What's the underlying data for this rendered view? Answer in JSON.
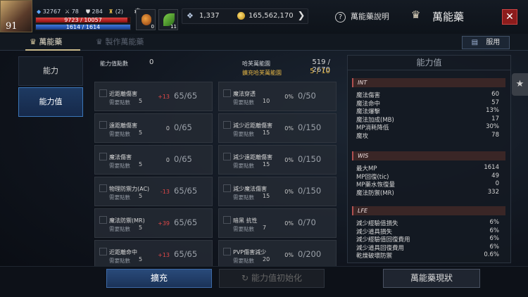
{
  "player": {
    "level": "91",
    "stat_a": "32767",
    "stat_b": "78",
    "stat_c": "284",
    "stat_d": "(2)",
    "hp_text": "9723 / 10057",
    "hp_fraction": 0.967,
    "mp_text": "1614 / 1614",
    "mp_fraction": 1.0,
    "slot1_count": "0",
    "slot2_count": "11"
  },
  "currency": {
    "crystal": "1,337",
    "gold": "165,562,170"
  },
  "header": {
    "help_label": "萬能藥說明",
    "title": "萬能藥",
    "close": "✕"
  },
  "tabs": {
    "tab1": "萬能藥",
    "tab2": "製作萬能藥",
    "serve": "服用"
  },
  "side": {
    "item1": "能力",
    "item2": "能力值"
  },
  "summary": {
    "points_label": "能力值點數",
    "points_value": "0",
    "gauge_label": "哈芙萬能園",
    "gauge_value": "519 / 2670",
    "expand_label": "擴充哈芙萬能園",
    "expand_value": "5 / 10"
  },
  "cards_left": [
    {
      "name": "近距離傷害",
      "need": "需要點數",
      "pts": "5",
      "mid": "+13",
      "val": "65/65"
    },
    {
      "name": "遠距離傷害",
      "need": "需要點數",
      "pts": "5",
      "mid": "0",
      "val": "0/65"
    },
    {
      "name": "魔法傷害",
      "need": "需要點數",
      "pts": "5",
      "mid": "0",
      "val": "0/65"
    },
    {
      "name": "物理防禦力(AC)",
      "need": "需要點數",
      "pts": "5",
      "mid": "-13",
      "val": "65/65"
    },
    {
      "name": "魔法防禦(MR)",
      "need": "需要點數",
      "pts": "5",
      "mid": "+39",
      "val": "65/65"
    },
    {
      "name": "近距離命中",
      "need": "需要點數",
      "pts": "5",
      "mid": "+13",
      "val": "65/65"
    }
  ],
  "cards_right": [
    {
      "name": "魔法穿透",
      "need": "需要點數",
      "pts": "10",
      "mid": "0%",
      "val": "0/50"
    },
    {
      "name": "減少近距離傷害",
      "need": "需要點數",
      "pts": "15",
      "mid": "0%",
      "val": "0/150"
    },
    {
      "name": "減少遠距離傷害",
      "need": "需要點數",
      "pts": "15",
      "mid": "0%",
      "val": "0/150"
    },
    {
      "name": "減少魔法傷害",
      "need": "需要點數",
      "pts": "15",
      "mid": "0%",
      "val": "0/150"
    },
    {
      "name": "暗黑 抗性",
      "need": "需要點數",
      "pts": "7",
      "mid": "0%",
      "val": "0/70"
    },
    {
      "name": "PVP傷害減少",
      "need": "需要點數",
      "pts": "20",
      "mid": "0%",
      "val": "0/200"
    }
  ],
  "panel": {
    "title": "能力值",
    "int_label": "INT",
    "int_rows": [
      {
        "k": "魔法傷害",
        "v": "60"
      },
      {
        "k": "魔法命中",
        "v": "57"
      },
      {
        "k": "魔法爆擊",
        "v": "13%"
      },
      {
        "k": "魔法加成(MB)",
        "v": "17"
      },
      {
        "k": "MP消耗降低",
        "v": "30%"
      },
      {
        "k": "魔攻",
        "v": "78"
      }
    ],
    "wis_label": "WIS",
    "wis_rows": [
      {
        "k": "最大MP",
        "v": "1614"
      },
      {
        "k": "MP回復(tic)",
        "v": "49"
      },
      {
        "k": "MP藥水恢復量",
        "v": "0"
      },
      {
        "k": "魔法防禦(MR)",
        "v": "332"
      }
    ],
    "lfe_label": "LFE",
    "lfe_rows": [
      {
        "k": "減少經驗值損失",
        "v": "6%"
      },
      {
        "k": "減少道具損失",
        "v": "6%"
      },
      {
        "k": "減少經驗值回復費用",
        "v": "6%"
      },
      {
        "k": "減少道具回復費用",
        "v": "6%"
      },
      {
        "k": "乾燥破壞防禦",
        "v": "0.6%"
      }
    ]
  },
  "bottom": {
    "expand": "擴充",
    "reset": "能力值初始化",
    "status": "萬能藥現狀"
  },
  "colors": {
    "accent_blue": "#3b76b8",
    "red_value": "#e04848",
    "gold": "#e5b646"
  }
}
